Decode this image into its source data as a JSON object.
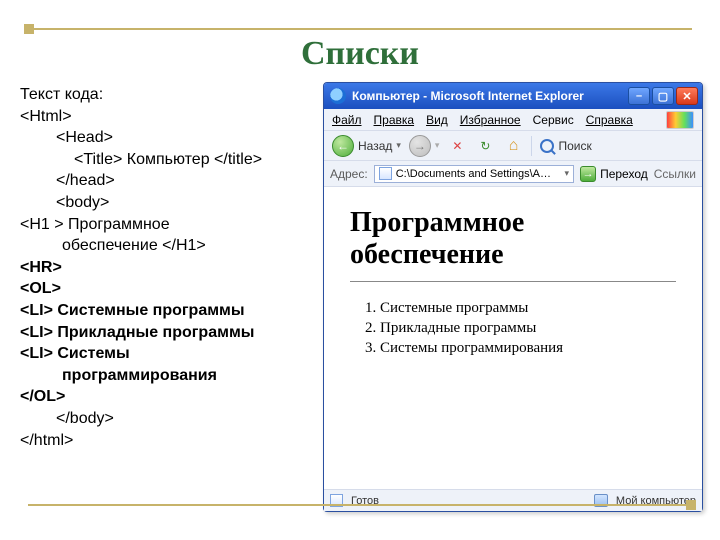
{
  "slide": {
    "title": "Списки",
    "code_intro": "Текст кода:",
    "code_lines": {
      "l0": "<Html>",
      "l1": "<Head>",
      "l2_open": "<Title>",
      "l2_text": " Компьютер ",
      "l2_close": "</title>",
      "l3": "</head>",
      "l4": "<body>",
      "l5_open": "<H1 >",
      "l5_text": " Программное",
      "l5_text2": "обеспечение ",
      "l5_close": "</H1>",
      "l6": "<HR>",
      "l7": "<OL>",
      "l8_open": "<LI>",
      "l8_text": " Системные программы",
      "l9_open": "<LI>",
      "l9_text": " Прикладные программы",
      "l10_open": "<LI>",
      "l10_text": " Системы",
      "l10_text2": "программирования",
      "l11": "</OL>",
      "l12": "</body>",
      "l13": "</html>"
    }
  },
  "browser": {
    "title": "Компьютер - Microsoft Internet Explorer",
    "menu": {
      "file": "Файл",
      "edit": "Правка",
      "view": "Вид",
      "favorites": "Избранное",
      "tools": "Сервис",
      "help": "Справка"
    },
    "toolbar": {
      "back": "Назад",
      "search": "Поиск",
      "back_arrow": "←",
      "fwd_arrow": "→",
      "dropdown": "▾",
      "stop": "✕",
      "refresh": "↻",
      "home": "⌂"
    },
    "addrbar": {
      "label": "Адрес:",
      "path": "C:\\Documents and Settings\\A…",
      "dropdown": "▾",
      "go": "Переход",
      "links": "Ссылки"
    },
    "page": {
      "heading": "Программное обеспечение",
      "items": [
        "Системные программы",
        "Прикладные программы",
        "Системы программирования"
      ]
    },
    "status": {
      "ready": "Готов",
      "zone": "Мой компьютер"
    }
  }
}
